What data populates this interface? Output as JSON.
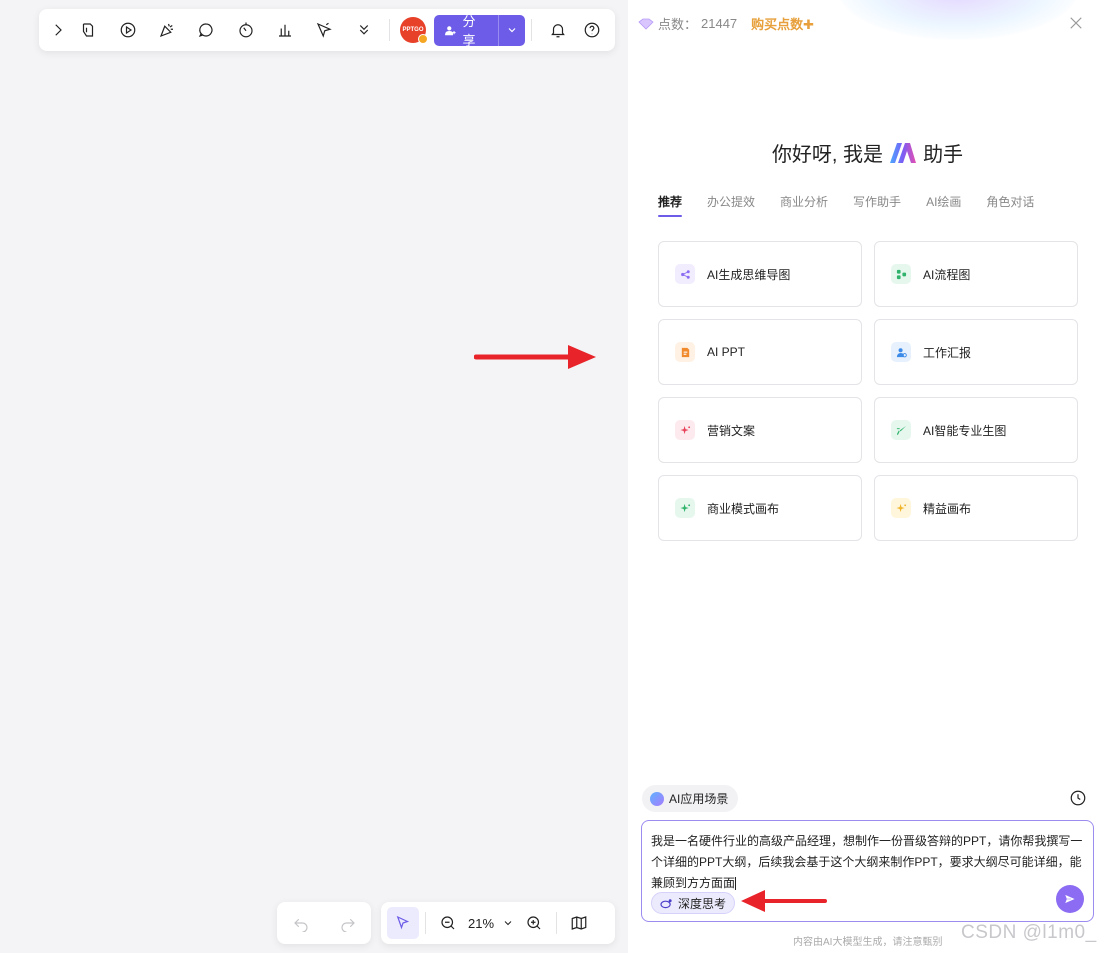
{
  "toolbar": {
    "avatar_text": "PPTGO",
    "share_label": "分享"
  },
  "panel": {
    "points_label": "点数：",
    "points_value": "21447",
    "buy_label": "购买点数✚",
    "greeting_prefix": "你好呀, 我是",
    "greeting_suffix": "助手",
    "tabs": [
      {
        "label": "推荐",
        "active": true
      },
      {
        "label": "办公提效"
      },
      {
        "label": "商业分析"
      },
      {
        "label": "写作助手"
      },
      {
        "label": "AI绘画"
      },
      {
        "label": "角色对话"
      }
    ],
    "cards": [
      {
        "label": "AI生成思维导图",
        "icon": "mindmap-icon",
        "color": "#8b6cf2",
        "bg": "#f1edff"
      },
      {
        "label": "AI流程图",
        "icon": "flowchart-icon",
        "color": "#2fb36b",
        "bg": "#e6f7ee"
      },
      {
        "label": "AI PPT",
        "icon": "ppt-file-icon",
        "color": "#f08a2c",
        "bg": "#fff1e4"
      },
      {
        "label": "工作汇报",
        "icon": "report-person-icon",
        "color": "#3d8be8",
        "bg": "#e7f1fd"
      },
      {
        "label": "营销文案",
        "icon": "sparkle-icon",
        "color": "#e8415a",
        "bg": "#fdeaee"
      },
      {
        "label": "AI智能专业生图",
        "icon": "brush-icon",
        "color": "#2fb36b",
        "bg": "#e6f7ee"
      },
      {
        "label": "商业模式画布",
        "icon": "sparkle-icon",
        "color": "#2fb36b",
        "bg": "#e6f7ee"
      },
      {
        "label": "精益画布",
        "icon": "sparkle-icon",
        "color": "#f0b429",
        "bg": "#fff6dc"
      }
    ],
    "scene_chip": "AI应用场景",
    "input_text": "我是一名硬件行业的高级产品经理，想制作一份晋级答辩的PPT，请你帮我撰写一个详细的PPT大纲，后续我会基于这个大纲来制作PPT，要求大纲尽可能详细，能兼顾到方方面面",
    "deep_think": "深度思考",
    "disclaimer": "内容由AI大模型生成，请注意甄别"
  },
  "bottom": {
    "zoom": "21%"
  },
  "watermark": "CSDN @l1m0_"
}
